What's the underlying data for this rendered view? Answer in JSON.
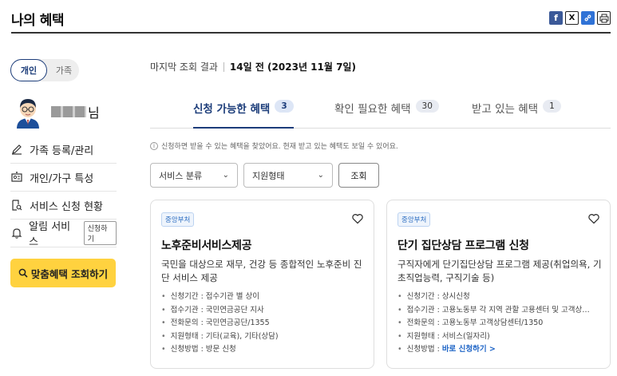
{
  "header": {
    "title": "나의 혜택",
    "share_icons": [
      "facebook-icon",
      "x-icon",
      "link-icon",
      "print-icon"
    ],
    "fb_glyph": "f",
    "x_glyph": "X"
  },
  "sidebar": {
    "toggle": {
      "active": "개인",
      "inactive": "가족"
    },
    "user_suffix": "님",
    "menu": [
      {
        "label": "가족 등록/관리",
        "icon": "pencil-icon"
      },
      {
        "label": "개인/가구 특성",
        "icon": "id-card-icon"
      },
      {
        "label": "서비스 신청 현황",
        "icon": "document-search-icon"
      },
      {
        "label": "알림 서비스",
        "icon": "bell-icon",
        "tag": "신청하기"
      }
    ],
    "search_button": "맞춤혜택 조회하기"
  },
  "main": {
    "last_query_label": "마지막 조회 결과",
    "last_query_value": "14일 전 (2023년 11월 7일)",
    "tabs": [
      {
        "label": "신청 가능한 혜택",
        "count": "3",
        "active": true
      },
      {
        "label": "확인 필요한 혜택",
        "count": "30",
        "active": false
      },
      {
        "label": "받고 있는 혜택",
        "count": "1",
        "active": false
      }
    ],
    "notice_glyph": "i",
    "notice": "신청하면 받을 수 있는 혜택을 찾았어요. 현재 받고 있는 혜택도 보일 수 있어요.",
    "filters": {
      "service_category": "서비스 분류",
      "support_type": "지원형태",
      "query_button": "조회"
    },
    "cards": [
      {
        "badge": "중앙부처",
        "title": "노후준비서비스제공",
        "description": "국민을 대상으로 재무, 건강 등 종합적인 노후준비 진단 서비스 제공",
        "info": [
          "신청기간 : 접수기관 별 상이",
          "접수기관 : 국민연금공단 지사",
          "전화문의 : 국민연금공단/1355",
          "지원형태 : 기타(교육), 기타(상담)",
          "신청방법 : 방문 신청"
        ]
      },
      {
        "badge": "중앙부처",
        "title": "단기 집단상담 프로그램 신청",
        "description": "구직자에게 단기집단상담 프로그램 제공(취업의욕, 기초직업능력, 구직기술 등)",
        "info": [
          "신청기간 : 상시신청",
          "접수기관 : 고용노동부 각 지역 관할 고용센터 및 고객상…",
          "전화문의 : 고용노동부 고객상담센터/1350",
          "지원형태 : 서비스(일자리)"
        ],
        "method_prefix": "신청방법 : ",
        "method_link": "바로 신청하기 >"
      }
    ]
  }
}
